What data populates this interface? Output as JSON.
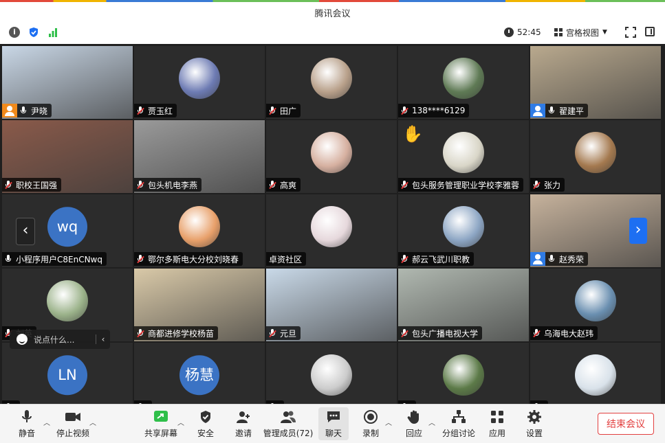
{
  "window": {
    "title": "腾讯会议"
  },
  "infobar": {
    "info_icon": "info-icon",
    "shield_icon": "shield-check-icon",
    "signal_icon": "signal-bars-icon",
    "duration": "52:45",
    "view_mode": "宫格视图"
  },
  "tiles": [
    {
      "name": "尹晓",
      "muted": false,
      "host": "orange",
      "kind": "video",
      "color": "#c9d7e6"
    },
    {
      "name": "贾玉红",
      "muted": true,
      "kind": "avatar",
      "color": "#6d7bb3"
    },
    {
      "name": "田广",
      "muted": true,
      "kind": "avatar",
      "color": "#b8a08a"
    },
    {
      "name": "138****6129",
      "muted": true,
      "kind": "avatar",
      "color": "#5f7a55"
    },
    {
      "name": "翟建平",
      "muted": false,
      "host": "blue",
      "kind": "video",
      "color": "#b9a98e",
      "active": true
    },
    {
      "name": "职校王国强",
      "muted": true,
      "kind": "video",
      "color": "#8a5a4a"
    },
    {
      "name": "包头机电李燕",
      "muted": true,
      "kind": "video",
      "color": "#9a9a9a"
    },
    {
      "name": "高爽",
      "muted": true,
      "kind": "avatar",
      "color": "#d6b0a0"
    },
    {
      "name": "包头服务管理职业学校李雅蓉",
      "muted": true,
      "kind": "avatar",
      "color": "#d9d6c8",
      "hand": true
    },
    {
      "name": "张力",
      "muted": true,
      "kind": "avatar",
      "color": "#a4794f"
    },
    {
      "name": "小程序用户C8EnCNwq",
      "muted": false,
      "kind": "text",
      "initials": "wq"
    },
    {
      "name": "鄂尔多斯电大分校刘晓春",
      "muted": true,
      "kind": "avatar",
      "color": "#e8a06a"
    },
    {
      "name": "卓资社区",
      "muted": null,
      "kind": "avatar",
      "color": "#e6d8dc"
    },
    {
      "name": "郝云飞武川职教",
      "muted": true,
      "kind": "avatar",
      "color": "#8da6c4"
    },
    {
      "name": "赵秀荣",
      "muted": false,
      "host": "blue",
      "kind": "video",
      "color": "#c6b29c"
    },
    {
      "name": "刘英",
      "muted": true,
      "kind": "avatar",
      "color": "#9bb28a"
    },
    {
      "name": "商都进修学校杨苗",
      "muted": true,
      "kind": "video",
      "color": "#d9c9a8"
    },
    {
      "name": "元旦",
      "muted": true,
      "kind": "video",
      "color": "#c9d9e8"
    },
    {
      "name": "包头广播电视大学",
      "muted": true,
      "kind": "video",
      "color": "#b0b8b0"
    },
    {
      "name": "乌海电大赵玮",
      "muted": true,
      "kind": "avatar",
      "color": "#6a8fb0"
    },
    {
      "name": "",
      "muted": true,
      "kind": "text",
      "initials": "LN"
    },
    {
      "name": "",
      "muted": true,
      "kind": "text",
      "initials": "杨慧"
    },
    {
      "name": "",
      "muted": true,
      "kind": "avatar",
      "color": "#cccccc"
    },
    {
      "name": "",
      "muted": true,
      "kind": "avatar",
      "color": "#5c7a48"
    },
    {
      "name": "",
      "muted": true,
      "kind": "avatar",
      "color": "#d9e2ea"
    }
  ],
  "nav": {
    "prev": "‹",
    "next": "›"
  },
  "chat_popup": {
    "placeholder": "说点什么...",
    "collapse": "‹"
  },
  "toolbar": {
    "mute": "静音",
    "stop_video": "停止视频",
    "share_screen": "共享屏幕",
    "security": "安全",
    "invite": "邀请",
    "manage_members": "管理成员(72)",
    "chat": "聊天",
    "record": "录制",
    "reactions": "回应",
    "breakout": "分组讨论",
    "apps": "应用",
    "settings": "设置",
    "end_meeting": "结束会议"
  },
  "colors": {
    "accent_blue": "#1d6ff2",
    "end_red": "#e23e3e",
    "active_green": "#2fbf4a",
    "host_orange": "#f08a1c"
  }
}
